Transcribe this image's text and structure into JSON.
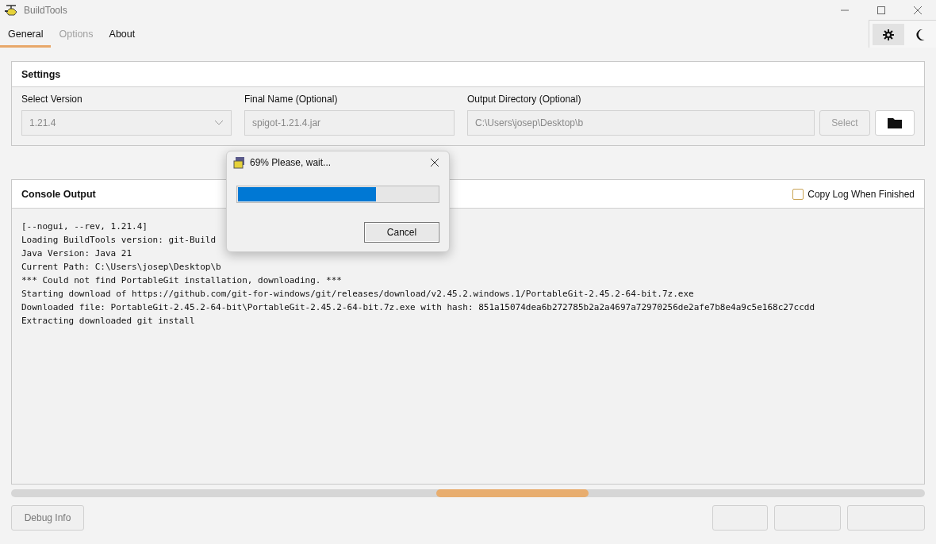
{
  "window": {
    "title": "BuildTools"
  },
  "tabs": [
    {
      "label": "General",
      "selected": true,
      "disabled": false
    },
    {
      "label": "Options",
      "selected": false,
      "disabled": true
    },
    {
      "label": "About",
      "selected": false,
      "disabled": false
    }
  ],
  "theme_toggle": [
    {
      "kind": "light",
      "selected": true
    },
    {
      "kind": "dark",
      "selected": false
    }
  ],
  "settings": {
    "title": "Settings",
    "version": {
      "label": "Select Version",
      "value": "1.21.4"
    },
    "final_name": {
      "label": "Final Name (Optional)",
      "value": "spigot-1.21.4.jar"
    },
    "output_directory": {
      "label": "Output Directory (Optional)",
      "value": "C:\\Users\\josep\\Desktop\\b",
      "select_button": "Select"
    }
  },
  "console": {
    "title": "Console Output",
    "copy_log": {
      "label": "Copy Log When Finished",
      "checked": false
    },
    "lines": [
      "[--nogui, --rev, 1.21.4]",
      "Loading BuildTools version: git-Build",
      "Java Version: Java 21",
      "Current Path: C:\\Users\\josep\\Desktop\\b",
      "*** Could not find PortableGit installation, downloading. ***",
      "Starting download of https://github.com/git-for-windows/git/releases/download/v2.45.2.windows.1/PortableGit-2.45.2-64-bit.7z.exe",
      "Downloaded file: PortableGit-2.45.2-64-bit\\PortableGit-2.45.2-64-bit.7z.exe with hash: 851a15074dea6b272785b2a2a4697a72970256de2afe7b8e4a9c5e168c27ccdd",
      "Extracting downloaded git install"
    ]
  },
  "build_progress": {
    "indeterminate": true
  },
  "footer": {
    "debug_button": "Debug Info",
    "other_buttons": [
      {
        "disabled": true
      },
      {
        "disabled": true
      },
      {
        "disabled": true
      }
    ]
  },
  "dialog": {
    "title": "69% Please, wait...",
    "level": 0.69,
    "cancel_button": "Cancel"
  }
}
